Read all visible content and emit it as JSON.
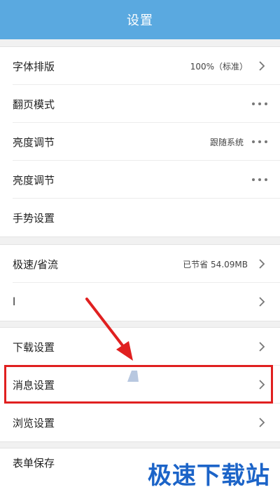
{
  "header": {
    "title": "设置"
  },
  "group1": [
    {
      "label": "字体排版",
      "value": "100%（标准）",
      "trailing": "chevron"
    },
    {
      "label": "翻页模式",
      "value": "",
      "trailing": "dots"
    },
    {
      "label": "亮度调节",
      "value": "跟随系统",
      "trailing": "dots"
    },
    {
      "label": "亮度调节",
      "value": "",
      "trailing": "dots"
    },
    {
      "label": "手势设置",
      "value": "",
      "trailing": "none"
    }
  ],
  "group2": [
    {
      "label": "极速/省流",
      "value": "已节省 54.09MB",
      "trailing": "chevron"
    },
    {
      "label": "l",
      "value": "",
      "trailing": "chevron"
    }
  ],
  "group3": [
    {
      "label": "下载设置",
      "value": "",
      "trailing": "chevron"
    },
    {
      "label": "消息设置",
      "value": "",
      "trailing": "chevron"
    },
    {
      "label": "浏览设置",
      "value": "",
      "trailing": "chevron"
    }
  ],
  "group4": [
    {
      "label": "表单保存",
      "value": "",
      "trailing": "none"
    }
  ],
  "watermark": "极速下载站",
  "colors": {
    "header": "#5aa9e0",
    "highlight": "#e02020",
    "watermark": "#1c64c8"
  }
}
